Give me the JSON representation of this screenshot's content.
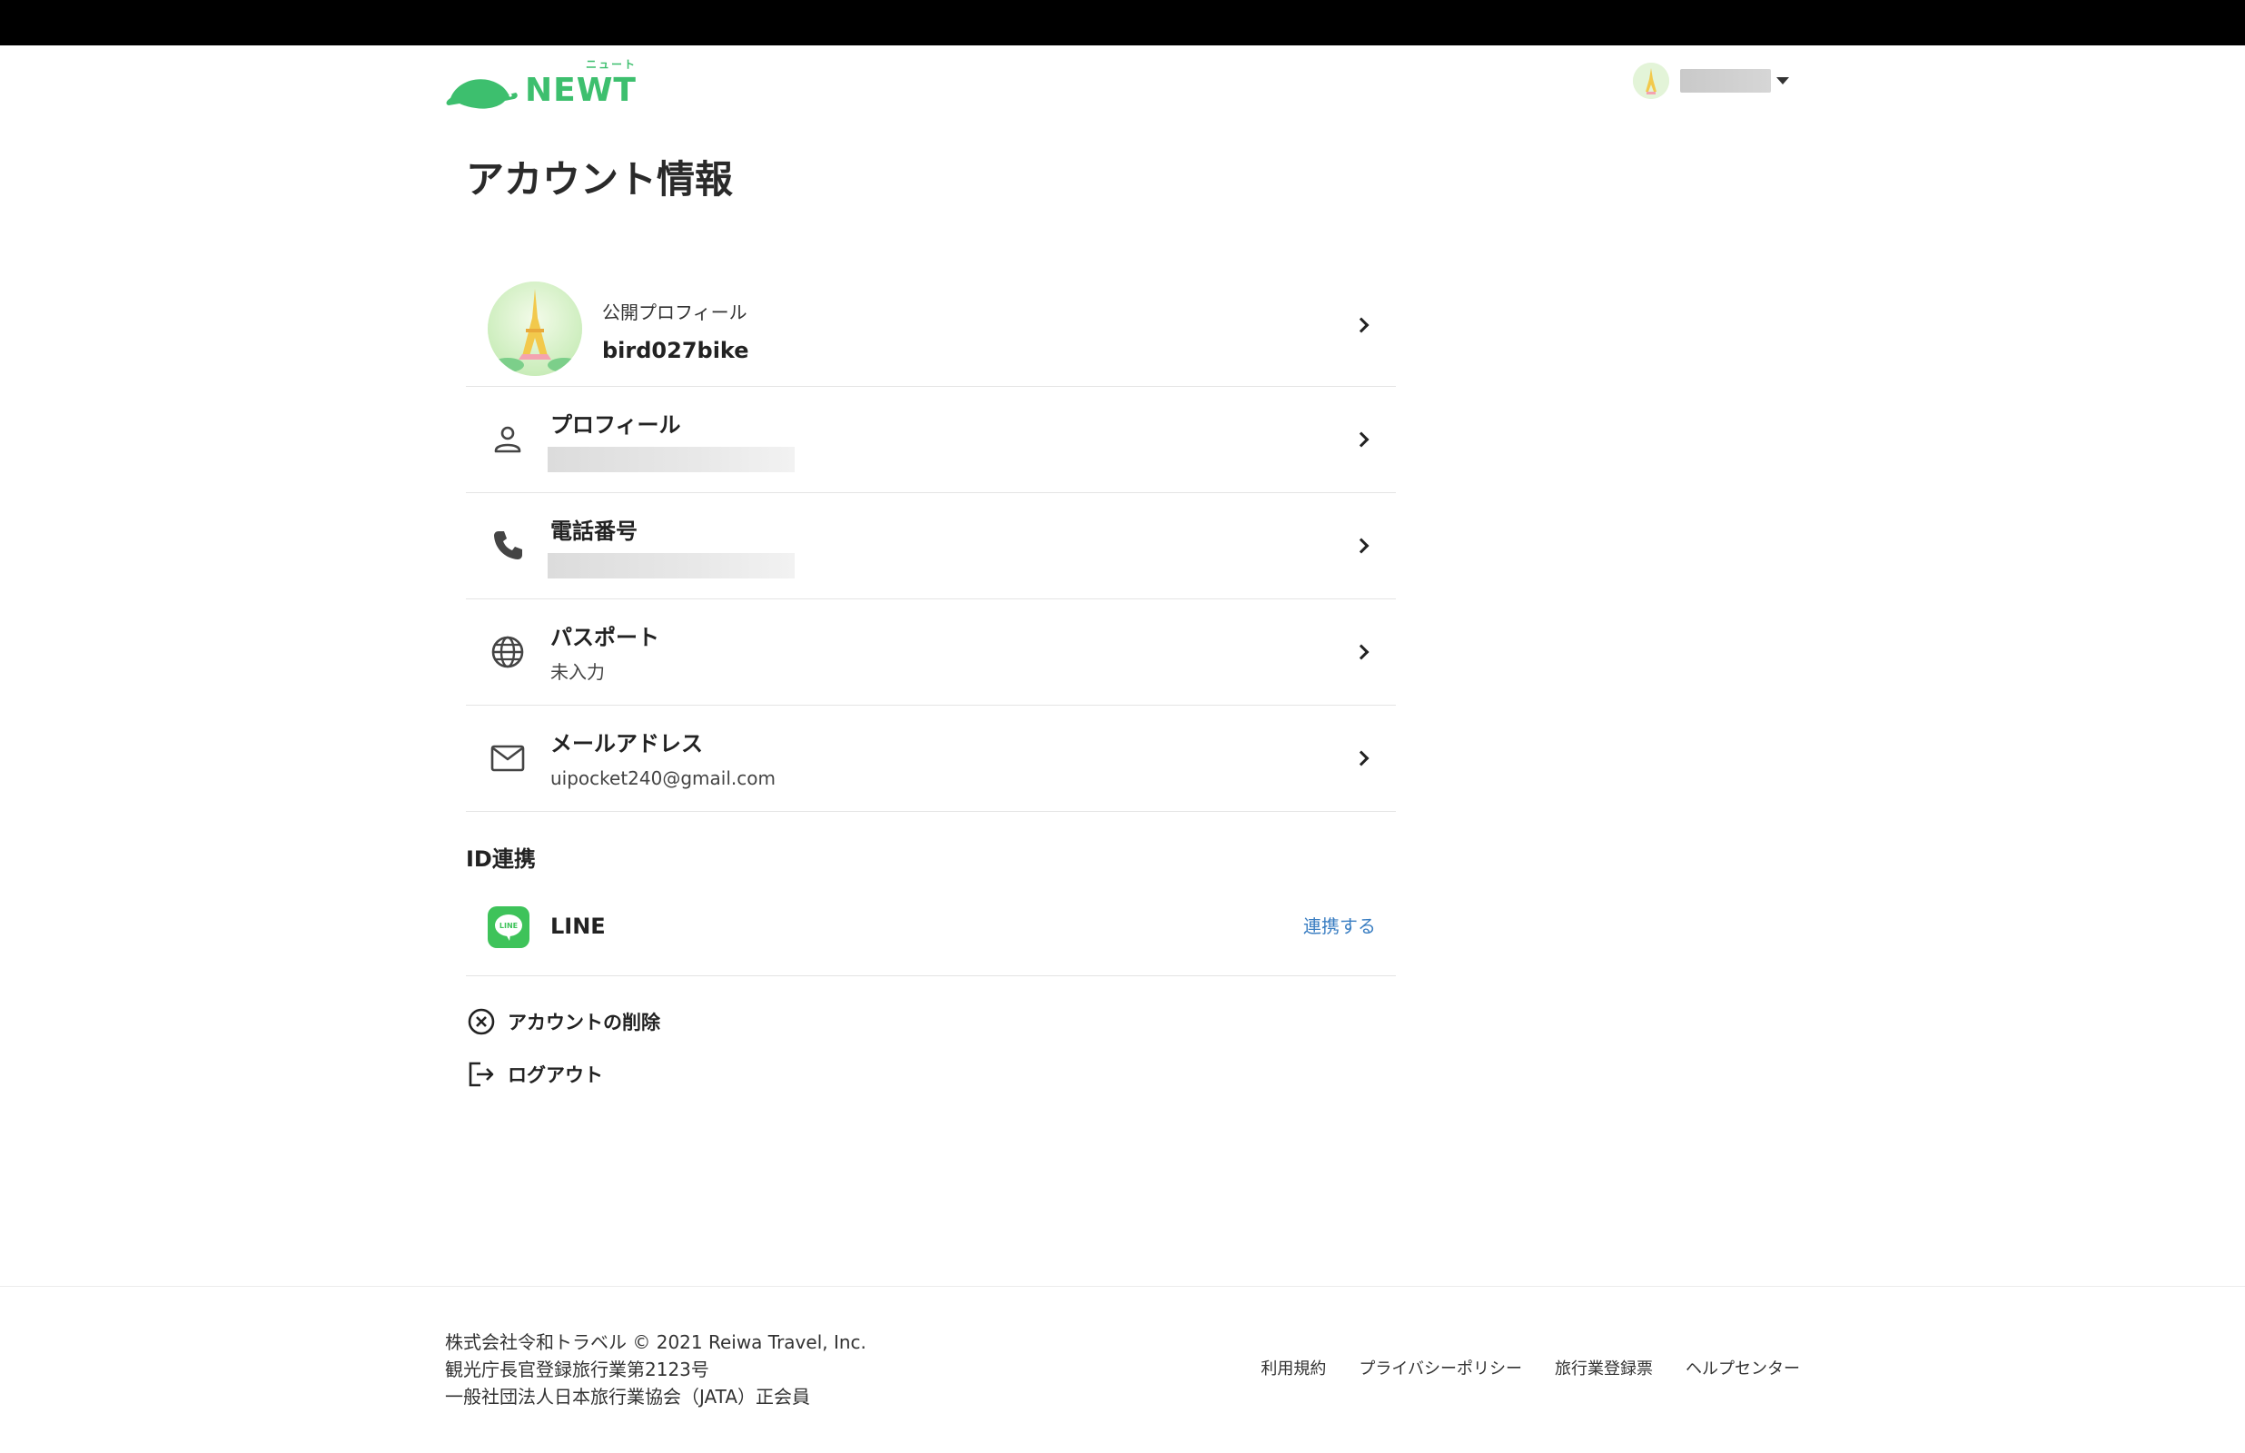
{
  "header": {
    "logo_text": "NEWT",
    "logo_ruby": "ニュート",
    "user_name": ""
  },
  "page": {
    "title": "アカウント情報"
  },
  "public_profile": {
    "label": "公開プロフィール",
    "username": "bird027bike"
  },
  "rows": [
    {
      "title": "プロフィール",
      "value": "",
      "icon": "person-icon"
    },
    {
      "title": "電話番号",
      "value": "",
      "icon": "phone-icon"
    },
    {
      "title": "パスポート",
      "value": "未入力",
      "icon": "globe-icon"
    },
    {
      "title": "メールアドレス",
      "value": "uipocket240@gmail.com",
      "icon": "mail-icon"
    }
  ],
  "id_link": {
    "section_title": "ID連携",
    "provider": "LINE",
    "icon_text": "LINE",
    "action": "連携する"
  },
  "actions": {
    "delete_account": "アカウントの削除",
    "logout": "ログアウト"
  },
  "footer": {
    "lines": [
      "株式会社令和トラベル © 2021 Reiwa Travel, Inc.",
      "観光庁長官登録旅行業第2123号",
      "一般社団法人日本旅行業協会（JATA）正会員"
    ],
    "links": [
      "利用規約",
      "プライバシーポリシー",
      "旅行業登録票",
      "ヘルプセンター"
    ]
  },
  "colors": {
    "brand_green": "#3dbf6e",
    "line_green": "#3ec35a",
    "link_blue": "#3a7ec2"
  }
}
